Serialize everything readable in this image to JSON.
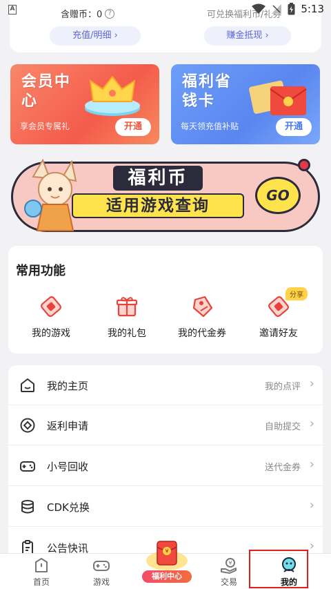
{
  "status_bar": {
    "time": "5:13",
    "app_icon": "A"
  },
  "top_card": {
    "coins_label": "含赠币：0",
    "help_symbol": "?",
    "exchange_text": "可兑换福利币/礼券",
    "recharge_btn": "充值/明细 ›",
    "earn_btn": "赚金抵现 ›"
  },
  "promos": [
    {
      "title": "会员中心",
      "subtitle": "享会员专属礼",
      "button": "开通"
    },
    {
      "title": "福利省钱卡",
      "subtitle": "每天领充值补贴",
      "button": "开通"
    }
  ],
  "banner": {
    "line1": "福利币",
    "line2": "适用游戏查询",
    "go": "GO"
  },
  "functions": {
    "title": "常用功能",
    "items": [
      {
        "label": "我的游戏",
        "icon": "game-ticket-icon"
      },
      {
        "label": "我的礼包",
        "icon": "gift-icon"
      },
      {
        "label": "我的代金券",
        "icon": "voucher-tag-icon"
      },
      {
        "label": "邀请好友",
        "icon": "invite-ticket-icon",
        "badge": "分享"
      }
    ]
  },
  "list": [
    {
      "label": "我的主页",
      "hint": "我的点评",
      "icon": "home-icon"
    },
    {
      "label": "返利申请",
      "hint": "自助提交",
      "icon": "rebate-icon"
    },
    {
      "label": "小号回收",
      "hint": "送代金券",
      "icon": "gamepad-icon"
    },
    {
      "label": "CDK兑换",
      "hint": "",
      "icon": "database-icon"
    },
    {
      "label": "公告快讯",
      "hint": "",
      "icon": "clipboard-icon"
    }
  ],
  "bottom_nav": {
    "items": [
      {
        "label": "首页",
        "icon": "home-nav-icon"
      },
      {
        "label": "游戏",
        "icon": "gamepad-nav-icon"
      },
      {
        "label": "福利中心",
        "icon": "welfare-center-icon"
      },
      {
        "label": "交易",
        "icon": "trade-icon"
      },
      {
        "label": "我的",
        "icon": "profile-icon"
      }
    ],
    "active": "我的"
  },
  "colors": {
    "accent": "#5b68d4",
    "vip": "#f45b4b",
    "welfare": "#5a86f0",
    "highlight": "#e01d1d"
  }
}
